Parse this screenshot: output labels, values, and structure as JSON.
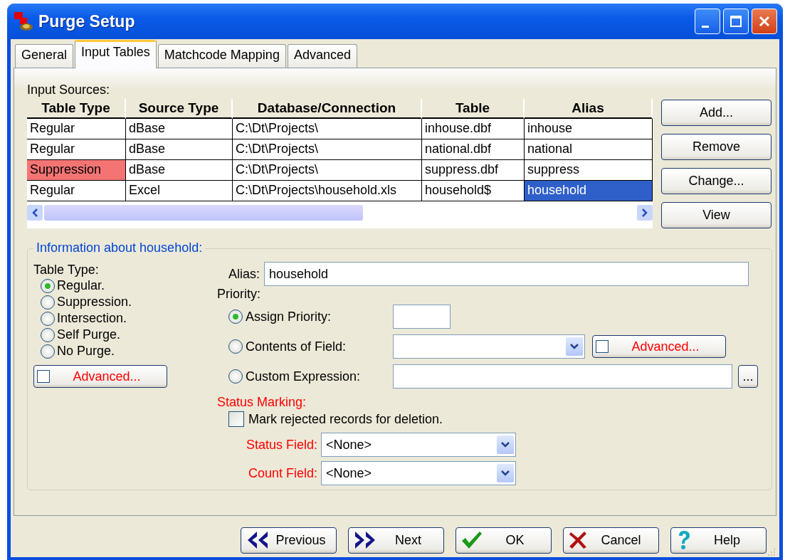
{
  "window": {
    "title": "Purge Setup"
  },
  "tabs": [
    {
      "label": "General",
      "selected": false
    },
    {
      "label": "Input Tables",
      "selected": true
    },
    {
      "label": "Matchcode Mapping",
      "selected": false
    },
    {
      "label": "Advanced",
      "selected": false
    }
  ],
  "input_sources": {
    "label": "Input Sources:",
    "columns": [
      "Table Type",
      "Source Type",
      "Database/Connection",
      "Table",
      "Alias"
    ],
    "rows": [
      {
        "cells": [
          {
            "text": "Regular",
            "flagged": false,
            "selected": false
          },
          {
            "text": "dBase",
            "flagged": false,
            "selected": false
          },
          {
            "text": "C:\\Dt\\Projects\\",
            "flagged": false,
            "selected": false
          },
          {
            "text": "inhouse.dbf",
            "flagged": false,
            "selected": false
          },
          {
            "text": "inhouse",
            "flagged": false,
            "selected": false
          }
        ]
      },
      {
        "cells": [
          {
            "text": "Regular",
            "flagged": false,
            "selected": false
          },
          {
            "text": "dBase",
            "flagged": false,
            "selected": false
          },
          {
            "text": "C:\\Dt\\Projects\\",
            "flagged": false,
            "selected": false
          },
          {
            "text": "national.dbf",
            "flagged": false,
            "selected": false
          },
          {
            "text": "national",
            "flagged": false,
            "selected": false
          }
        ]
      },
      {
        "cells": [
          {
            "text": "Suppression",
            "flagged": true,
            "selected": false
          },
          {
            "text": "dBase",
            "flagged": false,
            "selected": false
          },
          {
            "text": "C:\\Dt\\Projects\\",
            "flagged": false,
            "selected": false
          },
          {
            "text": "suppress.dbf",
            "flagged": false,
            "selected": false
          },
          {
            "text": "suppress",
            "flagged": false,
            "selected": false
          }
        ]
      },
      {
        "cells": [
          {
            "text": "Regular",
            "flagged": false,
            "selected": false
          },
          {
            "text": "Excel",
            "flagged": false,
            "selected": false
          },
          {
            "text": "C:\\Dt\\Projects\\household.xls",
            "flagged": false,
            "selected": false
          },
          {
            "text": "household$",
            "flagged": false,
            "selected": false
          },
          {
            "text": "household",
            "flagged": false,
            "selected": true
          }
        ]
      }
    ],
    "buttons": [
      "Add...",
      "Remove",
      "Change...",
      "View"
    ]
  },
  "info": {
    "title": "Information about household:",
    "table_type": {
      "label": "Table Type:",
      "options": [
        {
          "label": "Regular.",
          "selected": true
        },
        {
          "label": "Suppression.",
          "selected": false
        },
        {
          "label": "Intersection.",
          "selected": false
        },
        {
          "label": "Self Purge.",
          "selected": false
        },
        {
          "label": "No Purge.",
          "selected": false
        }
      ],
      "advanced_button": {
        "label": "Advanced...",
        "checked": false
      }
    },
    "alias": {
      "label": "Alias:",
      "value": "household"
    },
    "priority": {
      "label": "Priority:",
      "options": [
        {
          "kind": "text",
          "label": "Assign Priority:",
          "selected": true
        },
        {
          "kind": "combo",
          "label": "Contents of Field:",
          "selected": false,
          "advanced_button": {
            "label": "Advanced...",
            "checked": false
          }
        },
        {
          "kind": "expression",
          "label": "Custom Expression:",
          "selected": false,
          "browse_button": "..."
        }
      ]
    },
    "status_marking": {
      "label": "Status Marking:",
      "checkbox": {
        "label": "Mark rejected records for deletion.",
        "checked": false
      },
      "fields": [
        {
          "label": "Status Field:",
          "value": "<None>"
        },
        {
          "label": "Count Field:",
          "value": "<None>"
        }
      ]
    }
  },
  "footer_buttons": [
    {
      "kind": "previous",
      "label": "Previous"
    },
    {
      "kind": "next",
      "label": "Next"
    },
    {
      "kind": "ok",
      "label": "OK"
    },
    {
      "kind": "cancel",
      "label": "Cancel"
    },
    {
      "kind": "help",
      "label": "Help"
    }
  ]
}
